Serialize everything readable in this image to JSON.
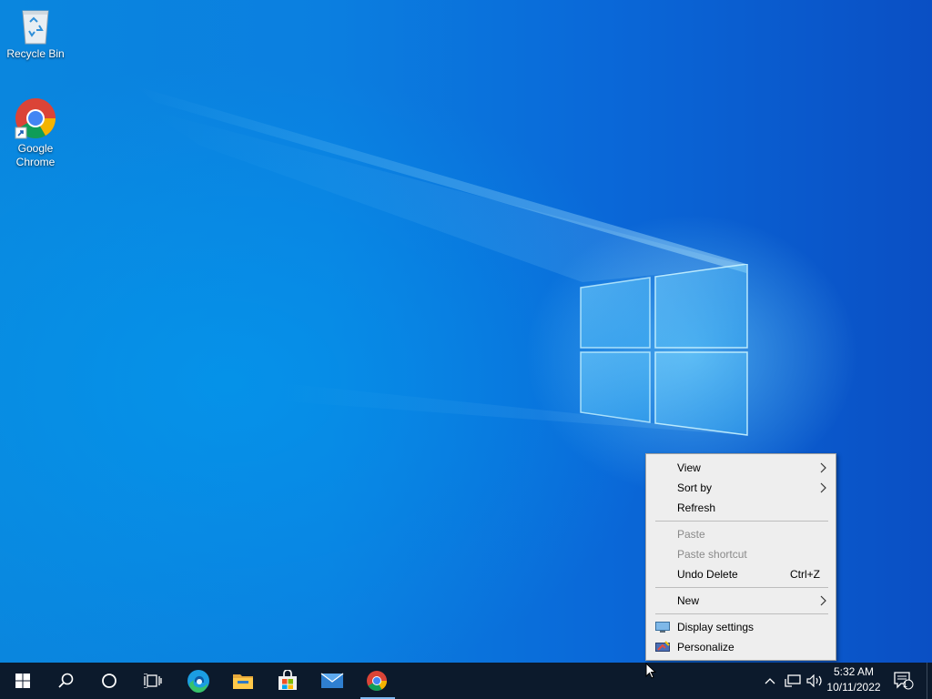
{
  "desktop": {
    "icons": [
      {
        "label": "Recycle Bin",
        "icon": "recycle-bin-icon"
      },
      {
        "label": "Google Chrome",
        "label_line1": "Google",
        "label_line2": "Chrome",
        "icon": "chrome-icon"
      }
    ]
  },
  "context_menu": {
    "items": [
      {
        "label": "View",
        "submenu": true,
        "enabled": true
      },
      {
        "label": "Sort by",
        "submenu": true,
        "enabled": true
      },
      {
        "label": "Refresh",
        "enabled": true
      },
      {
        "label": "Paste",
        "enabled": false
      },
      {
        "label": "Paste shortcut",
        "enabled": false
      },
      {
        "label": "Undo Delete",
        "shortcut": "Ctrl+Z",
        "enabled": true
      },
      {
        "label": "New",
        "submenu": true,
        "enabled": true
      },
      {
        "label": "Display settings",
        "icon": "display-icon",
        "enabled": true
      },
      {
        "label": "Personalize",
        "icon": "personalize-icon",
        "enabled": true
      }
    ]
  },
  "taskbar": {
    "buttons": [
      "start-icon",
      "search-icon",
      "cortana-icon",
      "task-view-icon",
      "edge-icon",
      "file-explorer-icon",
      "store-icon",
      "mail-icon",
      "chrome-icon"
    ],
    "active_app": "Google Chrome",
    "tray": {
      "time": "5:32 AM",
      "date": "10/11/2022",
      "notification_count": "1"
    }
  },
  "colors": {
    "taskbar_bg": "#0c1a2c",
    "menu_bg": "#eeeeee",
    "active_indicator": "#7db7ef",
    "disabled_text": "#8a8a8a"
  }
}
